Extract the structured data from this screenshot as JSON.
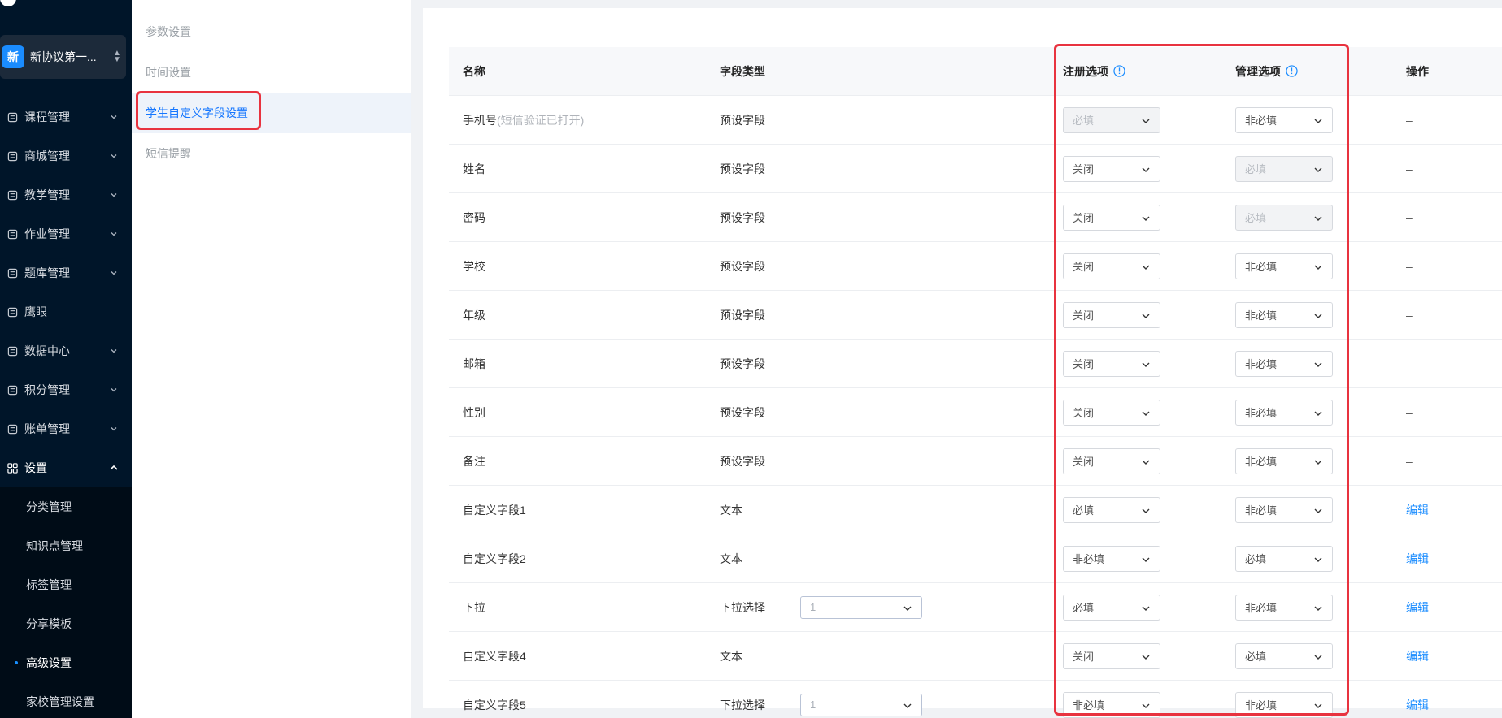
{
  "org": {
    "avatar": "新",
    "name": "新协议第一..."
  },
  "sidebar": {
    "items": [
      {
        "label": "课程管理",
        "icon": "book-icon",
        "arrow": true
      },
      {
        "label": "商城管理",
        "icon": "store-icon",
        "arrow": true
      },
      {
        "label": "教学管理",
        "icon": "teaching-icon",
        "arrow": true
      },
      {
        "label": "作业管理",
        "icon": "homework-icon",
        "arrow": true
      },
      {
        "label": "题库管理",
        "icon": "question-bank-icon",
        "arrow": true
      },
      {
        "label": "鹰眼",
        "icon": "eagle-eye-icon",
        "arrow": false
      },
      {
        "label": "数据中心",
        "icon": "chart-icon",
        "arrow": true
      },
      {
        "label": "积分管理",
        "icon": "star-icon",
        "arrow": true
      },
      {
        "label": "账单管理",
        "icon": "bill-icon",
        "arrow": true
      },
      {
        "label": "设置",
        "icon": "settings-grid-icon",
        "arrow": true,
        "expanded": true
      }
    ],
    "settings_children": [
      "分类管理",
      "知识点管理",
      "标签管理",
      "分享模板",
      "高级设置",
      "家校管理设置"
    ],
    "current_child": "高级设置"
  },
  "subnav": {
    "items": [
      "参数设置",
      "时间设置",
      "学生自定义字段设置",
      "短信提醒"
    ],
    "selected": "学生自定义字段设置"
  },
  "table": {
    "headers": {
      "name": "名称",
      "type": "字段类型",
      "reg": "注册选项",
      "mgr": "管理选项",
      "op": "操作"
    },
    "rows": [
      {
        "name": "手机号",
        "hint": "(短信验证已打开)",
        "type": "预设字段",
        "extra": null,
        "reg": "必填",
        "reg_disabled": true,
        "mgr": "非必填",
        "mgr_disabled": false,
        "op": "–"
      },
      {
        "name": "姓名",
        "hint": "",
        "type": "预设字段",
        "extra": null,
        "reg": "关闭",
        "reg_disabled": false,
        "mgr": "必填",
        "mgr_disabled": true,
        "op": "–"
      },
      {
        "name": "密码",
        "hint": "",
        "type": "预设字段",
        "extra": null,
        "reg": "关闭",
        "reg_disabled": false,
        "mgr": "必填",
        "mgr_disabled": true,
        "op": "–"
      },
      {
        "name": "学校",
        "hint": "",
        "type": "预设字段",
        "extra": null,
        "reg": "关闭",
        "reg_disabled": false,
        "mgr": "非必填",
        "mgr_disabled": false,
        "op": "–"
      },
      {
        "name": "年级",
        "hint": "",
        "type": "预设字段",
        "extra": null,
        "reg": "关闭",
        "reg_disabled": false,
        "mgr": "非必填",
        "mgr_disabled": false,
        "op": "–"
      },
      {
        "name": "邮箱",
        "hint": "",
        "type": "预设字段",
        "extra": null,
        "reg": "关闭",
        "reg_disabled": false,
        "mgr": "非必填",
        "mgr_disabled": false,
        "op": "–"
      },
      {
        "name": "性别",
        "hint": "",
        "type": "预设字段",
        "extra": null,
        "reg": "关闭",
        "reg_disabled": false,
        "mgr": "非必填",
        "mgr_disabled": false,
        "op": "–"
      },
      {
        "name": "备注",
        "hint": "",
        "type": "预设字段",
        "extra": null,
        "reg": "关闭",
        "reg_disabled": false,
        "mgr": "非必填",
        "mgr_disabled": false,
        "op": "–"
      },
      {
        "name": "自定义字段1",
        "hint": "",
        "type": "文本",
        "extra": null,
        "reg": "必填",
        "reg_disabled": false,
        "mgr": "非必填",
        "mgr_disabled": false,
        "op": "编辑"
      },
      {
        "name": "自定义字段2",
        "hint": "",
        "type": "文本",
        "extra": null,
        "reg": "非必填",
        "reg_disabled": false,
        "mgr": "必填",
        "mgr_disabled": false,
        "op": "编辑"
      },
      {
        "name": "下拉",
        "hint": "",
        "type": "下拉选择",
        "extra": "1",
        "reg": "必填",
        "reg_disabled": false,
        "mgr": "非必填",
        "mgr_disabled": false,
        "op": "编辑"
      },
      {
        "name": "自定义字段4",
        "hint": "",
        "type": "文本",
        "extra": null,
        "reg": "关闭",
        "reg_disabled": false,
        "mgr": "必填",
        "mgr_disabled": false,
        "op": "编辑"
      },
      {
        "name": "自定义字段5",
        "hint": "",
        "type": "下拉选择",
        "extra": "1",
        "reg": "非必填",
        "reg_disabled": false,
        "mgr": "非必填",
        "mgr_disabled": false,
        "op": "编辑"
      }
    ]
  },
  "colors": {
    "accent": "#1677ff",
    "highlight": "#e8333f",
    "sidebar_bg": "#001529"
  }
}
